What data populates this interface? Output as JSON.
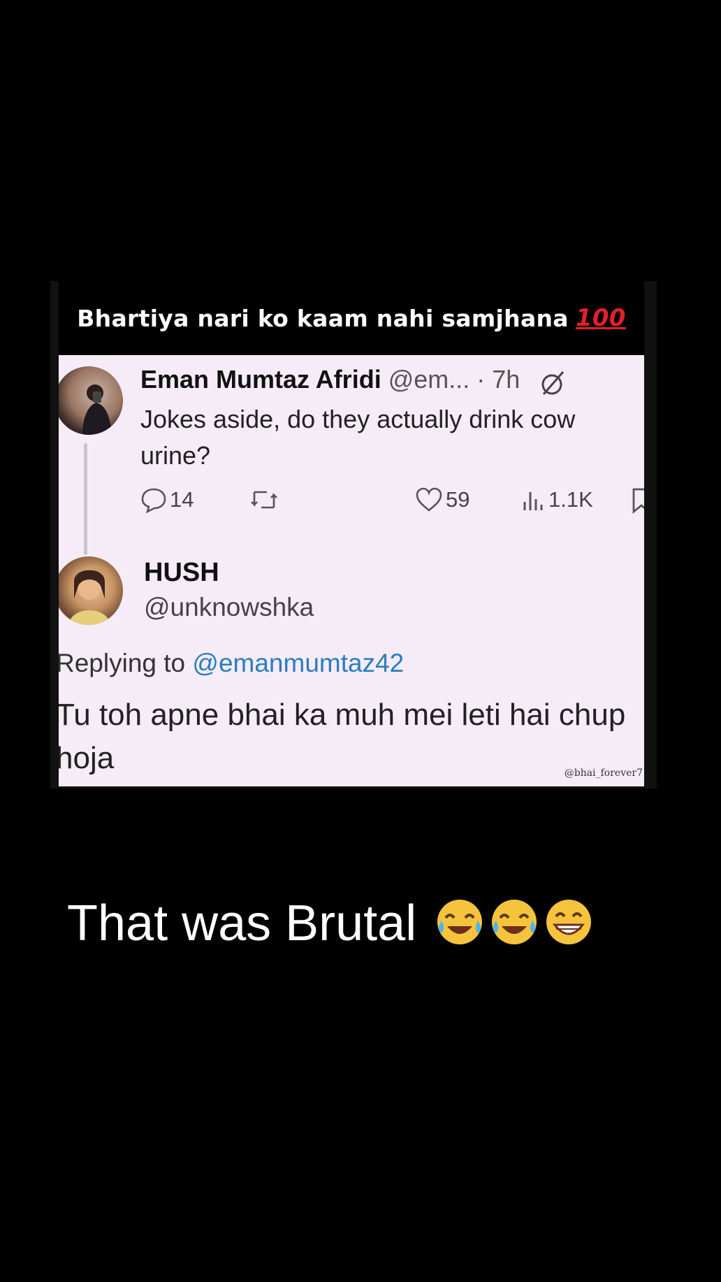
{
  "banner": {
    "text": "Bhartiya nari ko kaam nahi samjhana",
    "emoji_text": "100"
  },
  "tweet1": {
    "name": "Eman Mumtaz Afridi",
    "handle": "@em...",
    "time": "· 7h",
    "text": "Jokes aside, do they actually drink cow urine?",
    "replies": "14",
    "likes": "59",
    "views": "1.1K"
  },
  "tweet2": {
    "name": "HUSH",
    "handle": "@unknowshka",
    "replying_prefix": "Replying to",
    "replying_to": "@emanmumtaz42",
    "text": "Tu toh apne bhai ka muh mei leti hai chup hoja"
  },
  "watermark": "@bhai_forever7",
  "caption": {
    "text": "That was Brutal",
    "emojis": [
      "tears-of-joy",
      "tears-of-joy",
      "grinning-face"
    ]
  },
  "colors": {
    "background": "#000000",
    "panel": "#f6ecf8",
    "mention": "#2b7dbe",
    "hundred": "#e0202a"
  }
}
